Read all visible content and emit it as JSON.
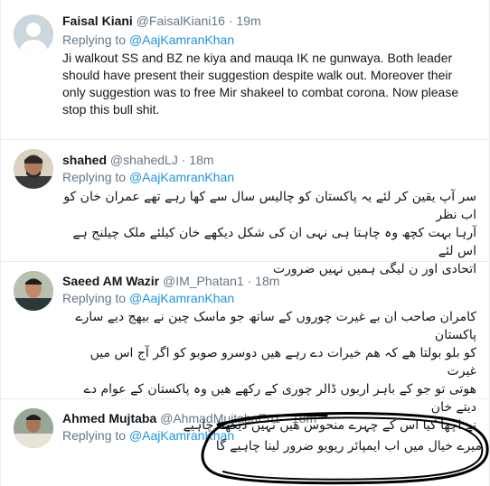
{
  "tweets": [
    {
      "name": "Faisal Kiani",
      "handle": "@FaisalKiani16",
      "time": "19m",
      "reply_prefix": "Replying to",
      "reply_to": "@AajKamranKhan",
      "text": "Ji walkout SS and BZ ne kiya and mauqa IK ne gunwaya. Both leader should have present their suggestion despite walk out. Moreover their only suggestion was to free Mir shakeel to combat corona. Now please stop this bull shit.",
      "avatar": "default-profile-icon"
    },
    {
      "name": "shahed",
      "handle": "@shahedLJ",
      "time": "18m",
      "reply_prefix": "Replying to",
      "reply_to": "@AajKamranKhan",
      "text_lines": [
        "سر آپ یقین کر لئے یہ پاکستان کو چالیس سال سے کھا رہے تھے عمران خان کو اب نظر",
        "آرہا بہت کچھ وہ چاہتا ہی نہی ان کی شکل دیکھے خان کیلئے ملک چیلنج ہے اس لئے",
        "اتحادی اور ن لیگی ہمیں نہیں ضرورت"
      ],
      "avatar": "user-photo"
    },
    {
      "name": "Saeed AM Wazir",
      "handle": "@IM_Phatan1",
      "time": "18m",
      "reply_prefix": "Replying to",
      "reply_to": "@AajKamranKhan",
      "text_lines": [
        "کامران صاحب ان بے غیرت چوروں کے ساتھ جو ماسک چین نے بیھج دیے سارے پاکستان",
        "کو بلو بولتا ھے کہ ھم خیرات دے رہے ھیں دوسرو صوبو کو اگر آج اس میں غیرت",
        "ھوتی تو جو کے باہر اربوں ڈالر چوری کے رکھے ھیں وہ پاکستان کے عوام دے دیتے خان",
        "نے اچھا کیا اس کے چہرے منحوس ھیں نہیں دیکھنا چاہیے"
      ],
      "avatar": "user-photo"
    },
    {
      "name": "Ahmed Mujtaba",
      "handle": "@AhmadMujtabaEn1",
      "time": "18m",
      "reply_prefix": "Replying to",
      "reply_to": "@AajKamranKhan",
      "text_lines": [
        "میرے خیال میں اب ایمپائر ریویو ضرور لینا چاہیے گا"
      ],
      "avatar": "user-photo"
    }
  ],
  "colors": {
    "link": "#1b95e0",
    "secondary_text": "#657786",
    "divider": "#e6ecf0",
    "annotation_stroke": "#000000"
  }
}
